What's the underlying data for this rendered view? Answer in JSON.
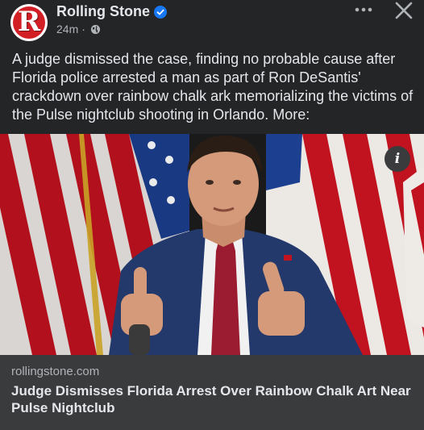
{
  "post": {
    "page_name": "Rolling Stone",
    "avatar_letter": "R",
    "timestamp": "24m",
    "separator": "·",
    "caption": "A judge dismissed the case, finding no probable cause after Florida police arrested a man as part of Ron DeSantis' crackdown over rainbow chalk ark memorializing the victims of the Pulse nightclub shooting in Orlando. More:",
    "more_icon": "more-dots-icon",
    "close_icon": "close-icon",
    "audience_icon": "globe-icon",
    "verified_icon": "verified-badge-icon"
  },
  "photo": {
    "info_label": "i"
  },
  "link": {
    "domain": "rollingstone.com",
    "title": "Judge Dismisses Florida Arrest Over Rainbow Chalk Art Near Pulse Nightclub"
  },
  "colors": {
    "background": "#242526",
    "link_card": "#3a3b3c",
    "verified": "#1877f2",
    "brand_red": "#d21f26"
  }
}
